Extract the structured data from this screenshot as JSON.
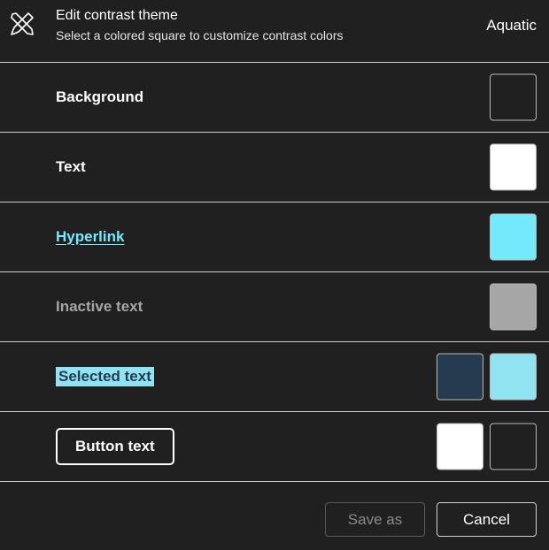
{
  "header": {
    "icon": "paint-brush-icon",
    "title": "Edit contrast theme",
    "subtitle": "Select a colored square to customize contrast colors",
    "theme_name": "Aquatic"
  },
  "rows": [
    {
      "label": "Background",
      "swatches": [
        "#202020"
      ]
    },
    {
      "label": "Text",
      "swatches": [
        "#ffffff"
      ]
    },
    {
      "label": "Hyperlink",
      "swatches": [
        "#75e9fc"
      ]
    },
    {
      "label": "Inactive text",
      "swatches": [
        "#a6a6a6"
      ]
    },
    {
      "label": "Selected text",
      "swatches": [
        "#263b50",
        "#90e3f0"
      ]
    },
    {
      "label": "Button text",
      "swatches": [
        "#ffffff",
        "#202020"
      ]
    }
  ],
  "footer": {
    "save_as_label": "Save as",
    "cancel_label": "Cancel"
  }
}
